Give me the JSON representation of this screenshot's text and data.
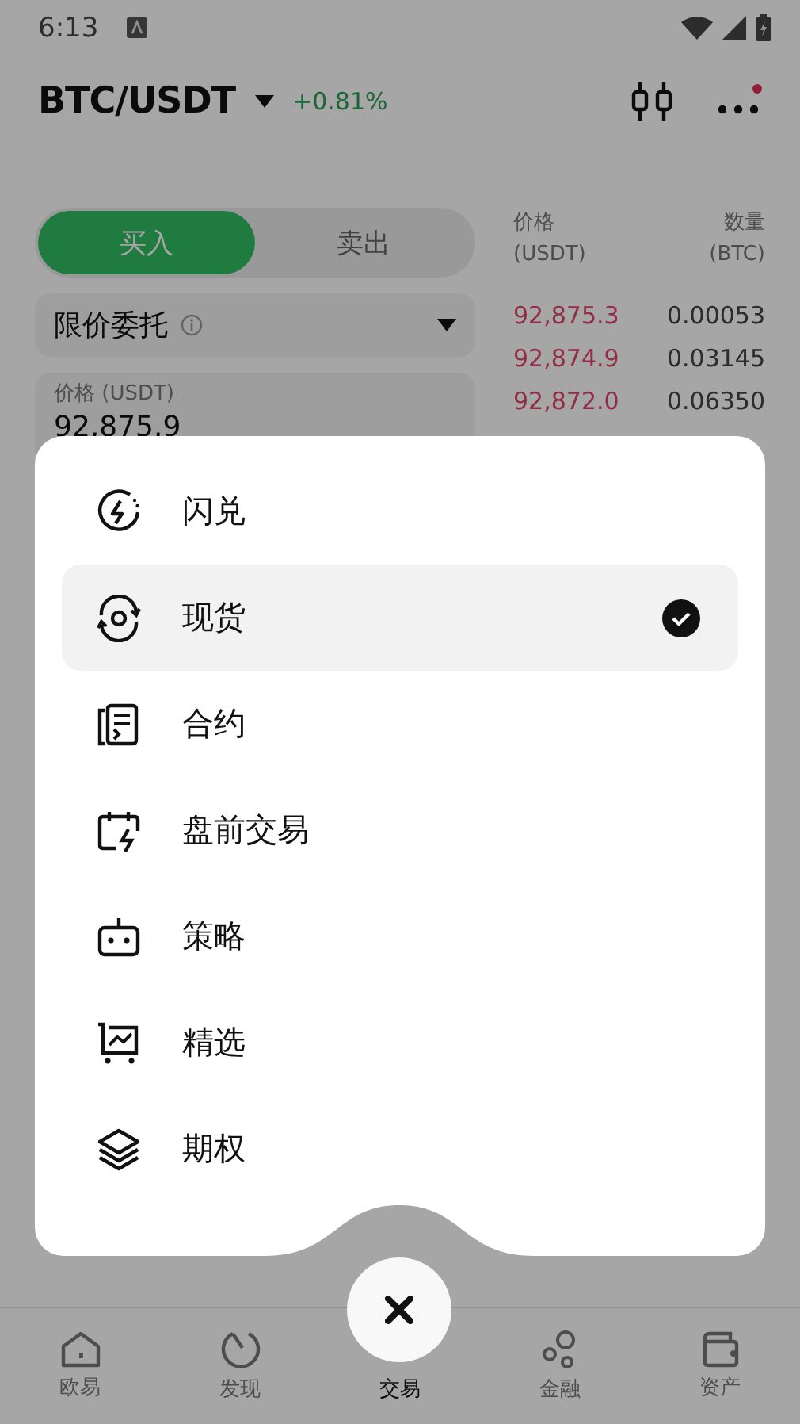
{
  "status_bar": {
    "time": "6:13"
  },
  "header": {
    "pair": "BTC/USDT",
    "change": "+0.81%"
  },
  "trade_form": {
    "sides": [
      {
        "label": "买入",
        "selected": true
      },
      {
        "label": "卖出",
        "selected": false
      }
    ],
    "order_type": "限价委托",
    "price_field": {
      "label": "价格 (USDT)",
      "value": "92,875.9"
    }
  },
  "order_book": {
    "columns": [
      {
        "label": "价格",
        "unit": "(USDT)"
      },
      {
        "label": "数量",
        "unit": "(BTC)"
      }
    ],
    "asks": [
      {
        "price": "92,875.3",
        "amount": "0.00053"
      },
      {
        "price": "92,874.9",
        "amount": "0.03145"
      },
      {
        "price": "92,872.0",
        "amount": "0.06350"
      }
    ]
  },
  "menu": {
    "items": [
      {
        "label": "闪兑",
        "selected": false
      },
      {
        "label": "现货",
        "selected": true
      },
      {
        "label": "合约",
        "selected": false
      },
      {
        "label": "盘前交易",
        "selected": false
      },
      {
        "label": "策略",
        "selected": false
      },
      {
        "label": "精选",
        "selected": false
      },
      {
        "label": "期权",
        "selected": false
      }
    ]
  },
  "nav": {
    "items": [
      {
        "label": "欧易",
        "selected": false
      },
      {
        "label": "发现",
        "selected": false
      },
      {
        "label": "交易",
        "selected": true
      },
      {
        "label": "金融",
        "selected": false
      },
      {
        "label": "资产",
        "selected": false
      }
    ]
  }
}
